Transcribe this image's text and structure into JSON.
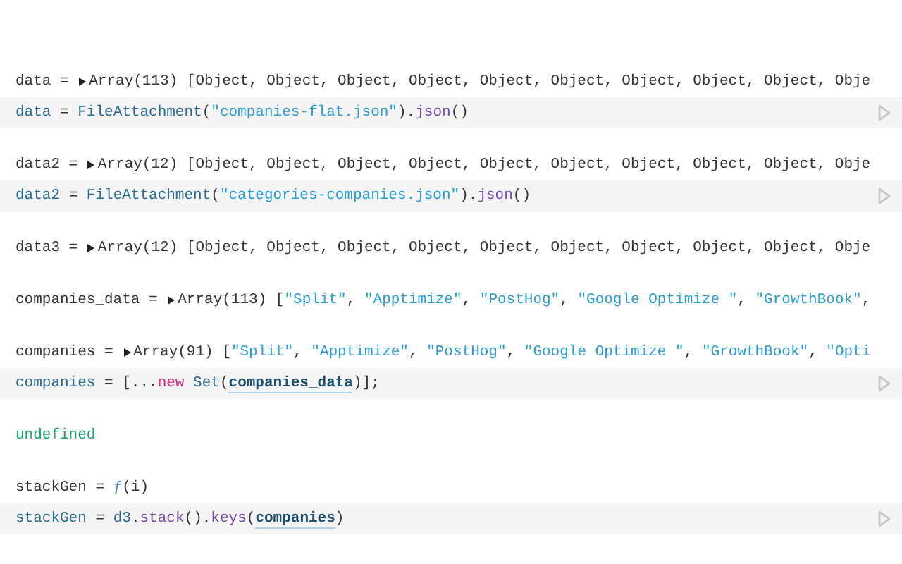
{
  "cells": [
    {
      "output": {
        "head": "data = ",
        "expanded": false,
        "body": [
          {
            "text": "Array(113) [Object, Object, Object, Object, Object, Object, Object, Object, Object, Obje",
            "kind": "plain"
          }
        ]
      },
      "code": [
        {
          "text": "data",
          "kind": "def"
        },
        {
          "text": " = ",
          "kind": "plain"
        },
        {
          "text": "FileAttachment",
          "kind": "name"
        },
        {
          "text": "(",
          "kind": "plain"
        },
        {
          "text": "\"companies-flat.json\"",
          "kind": "string"
        },
        {
          "text": ").",
          "kind": "plain"
        },
        {
          "text": "json",
          "kind": "method"
        },
        {
          "text": "()",
          "kind": "plain"
        }
      ]
    },
    {
      "output": {
        "head": "data2 = ",
        "expanded": false,
        "body": [
          {
            "text": "Array(12) [Object, Object, Object, Object, Object, Object, Object, Object, Object, Obje",
            "kind": "plain"
          }
        ]
      },
      "code": [
        {
          "text": "data2",
          "kind": "def"
        },
        {
          "text": " = ",
          "kind": "plain"
        },
        {
          "text": "FileAttachment",
          "kind": "name"
        },
        {
          "text": "(",
          "kind": "plain"
        },
        {
          "text": "\"categories-companies.json\"",
          "kind": "string"
        },
        {
          "text": ").",
          "kind": "plain"
        },
        {
          "text": "json",
          "kind": "method"
        },
        {
          "text": "()",
          "kind": "plain"
        }
      ]
    },
    {
      "output": {
        "head": "data3 = ",
        "expanded": false,
        "body": [
          {
            "text": "Array(12) [Object, Object, Object, Object, Object, Object, Object, Object, Object, Obje",
            "kind": "plain"
          }
        ]
      }
    },
    {
      "output": {
        "head": "companies_data = ",
        "expanded": false,
        "body": [
          {
            "text": "Array(113) [",
            "kind": "plain"
          },
          {
            "text": "\"Split\"",
            "kind": "string"
          },
          {
            "text": ", ",
            "kind": "plain"
          },
          {
            "text": "\"Apptimize\"",
            "kind": "string"
          },
          {
            "text": ", ",
            "kind": "plain"
          },
          {
            "text": "\"PostHog\"",
            "kind": "string"
          },
          {
            "text": ", ",
            "kind": "plain"
          },
          {
            "text": "\"Google Optimize \"",
            "kind": "string"
          },
          {
            "text": ", ",
            "kind": "plain"
          },
          {
            "text": "\"GrowthBook\"",
            "kind": "string"
          },
          {
            "text": ",",
            "kind": "plain"
          }
        ]
      }
    },
    {
      "output": {
        "head": "companies = ",
        "expanded": false,
        "body": [
          {
            "text": "Array(91) [",
            "kind": "plain"
          },
          {
            "text": "\"Split\"",
            "kind": "string"
          },
          {
            "text": ", ",
            "kind": "plain"
          },
          {
            "text": "\"Apptimize\"",
            "kind": "string"
          },
          {
            "text": ", ",
            "kind": "plain"
          },
          {
            "text": "\"PostHog\"",
            "kind": "string"
          },
          {
            "text": ", ",
            "kind": "plain"
          },
          {
            "text": "\"Google Optimize \"",
            "kind": "string"
          },
          {
            "text": ", ",
            "kind": "plain"
          },
          {
            "text": "\"GrowthBook\"",
            "kind": "string"
          },
          {
            "text": ", ",
            "kind": "plain"
          },
          {
            "text": "\"Opti",
            "kind": "string"
          }
        ]
      },
      "code": [
        {
          "text": "companies",
          "kind": "def"
        },
        {
          "text": " = [...",
          "kind": "plain"
        },
        {
          "text": "new",
          "kind": "keyword"
        },
        {
          "text": " Set",
          "kind": "name"
        },
        {
          "text": "(",
          "kind": "plain"
        },
        {
          "text": "companies_data",
          "kind": "ref"
        },
        {
          "text": ")];",
          "kind": "plain"
        }
      ]
    },
    {
      "output": {
        "body": [
          {
            "text": "undefined",
            "kind": "undefined"
          }
        ]
      }
    },
    {
      "output": {
        "head": "stackGen = ",
        "body": [
          {
            "text": "ƒ",
            "kind": "fn"
          },
          {
            "text": "(i)",
            "kind": "plain"
          }
        ]
      },
      "code": [
        {
          "text": "stackGen",
          "kind": "def"
        },
        {
          "text": " = ",
          "kind": "plain"
        },
        {
          "text": "d3",
          "kind": "name"
        },
        {
          "text": ".",
          "kind": "plain"
        },
        {
          "text": "stack",
          "kind": "method"
        },
        {
          "text": "().",
          "kind": "plain"
        },
        {
          "text": "keys",
          "kind": "method"
        },
        {
          "text": "(",
          "kind": "plain"
        },
        {
          "text": "companies",
          "kind": "ref"
        },
        {
          "text": ")",
          "kind": "plain"
        }
      ]
    }
  ]
}
